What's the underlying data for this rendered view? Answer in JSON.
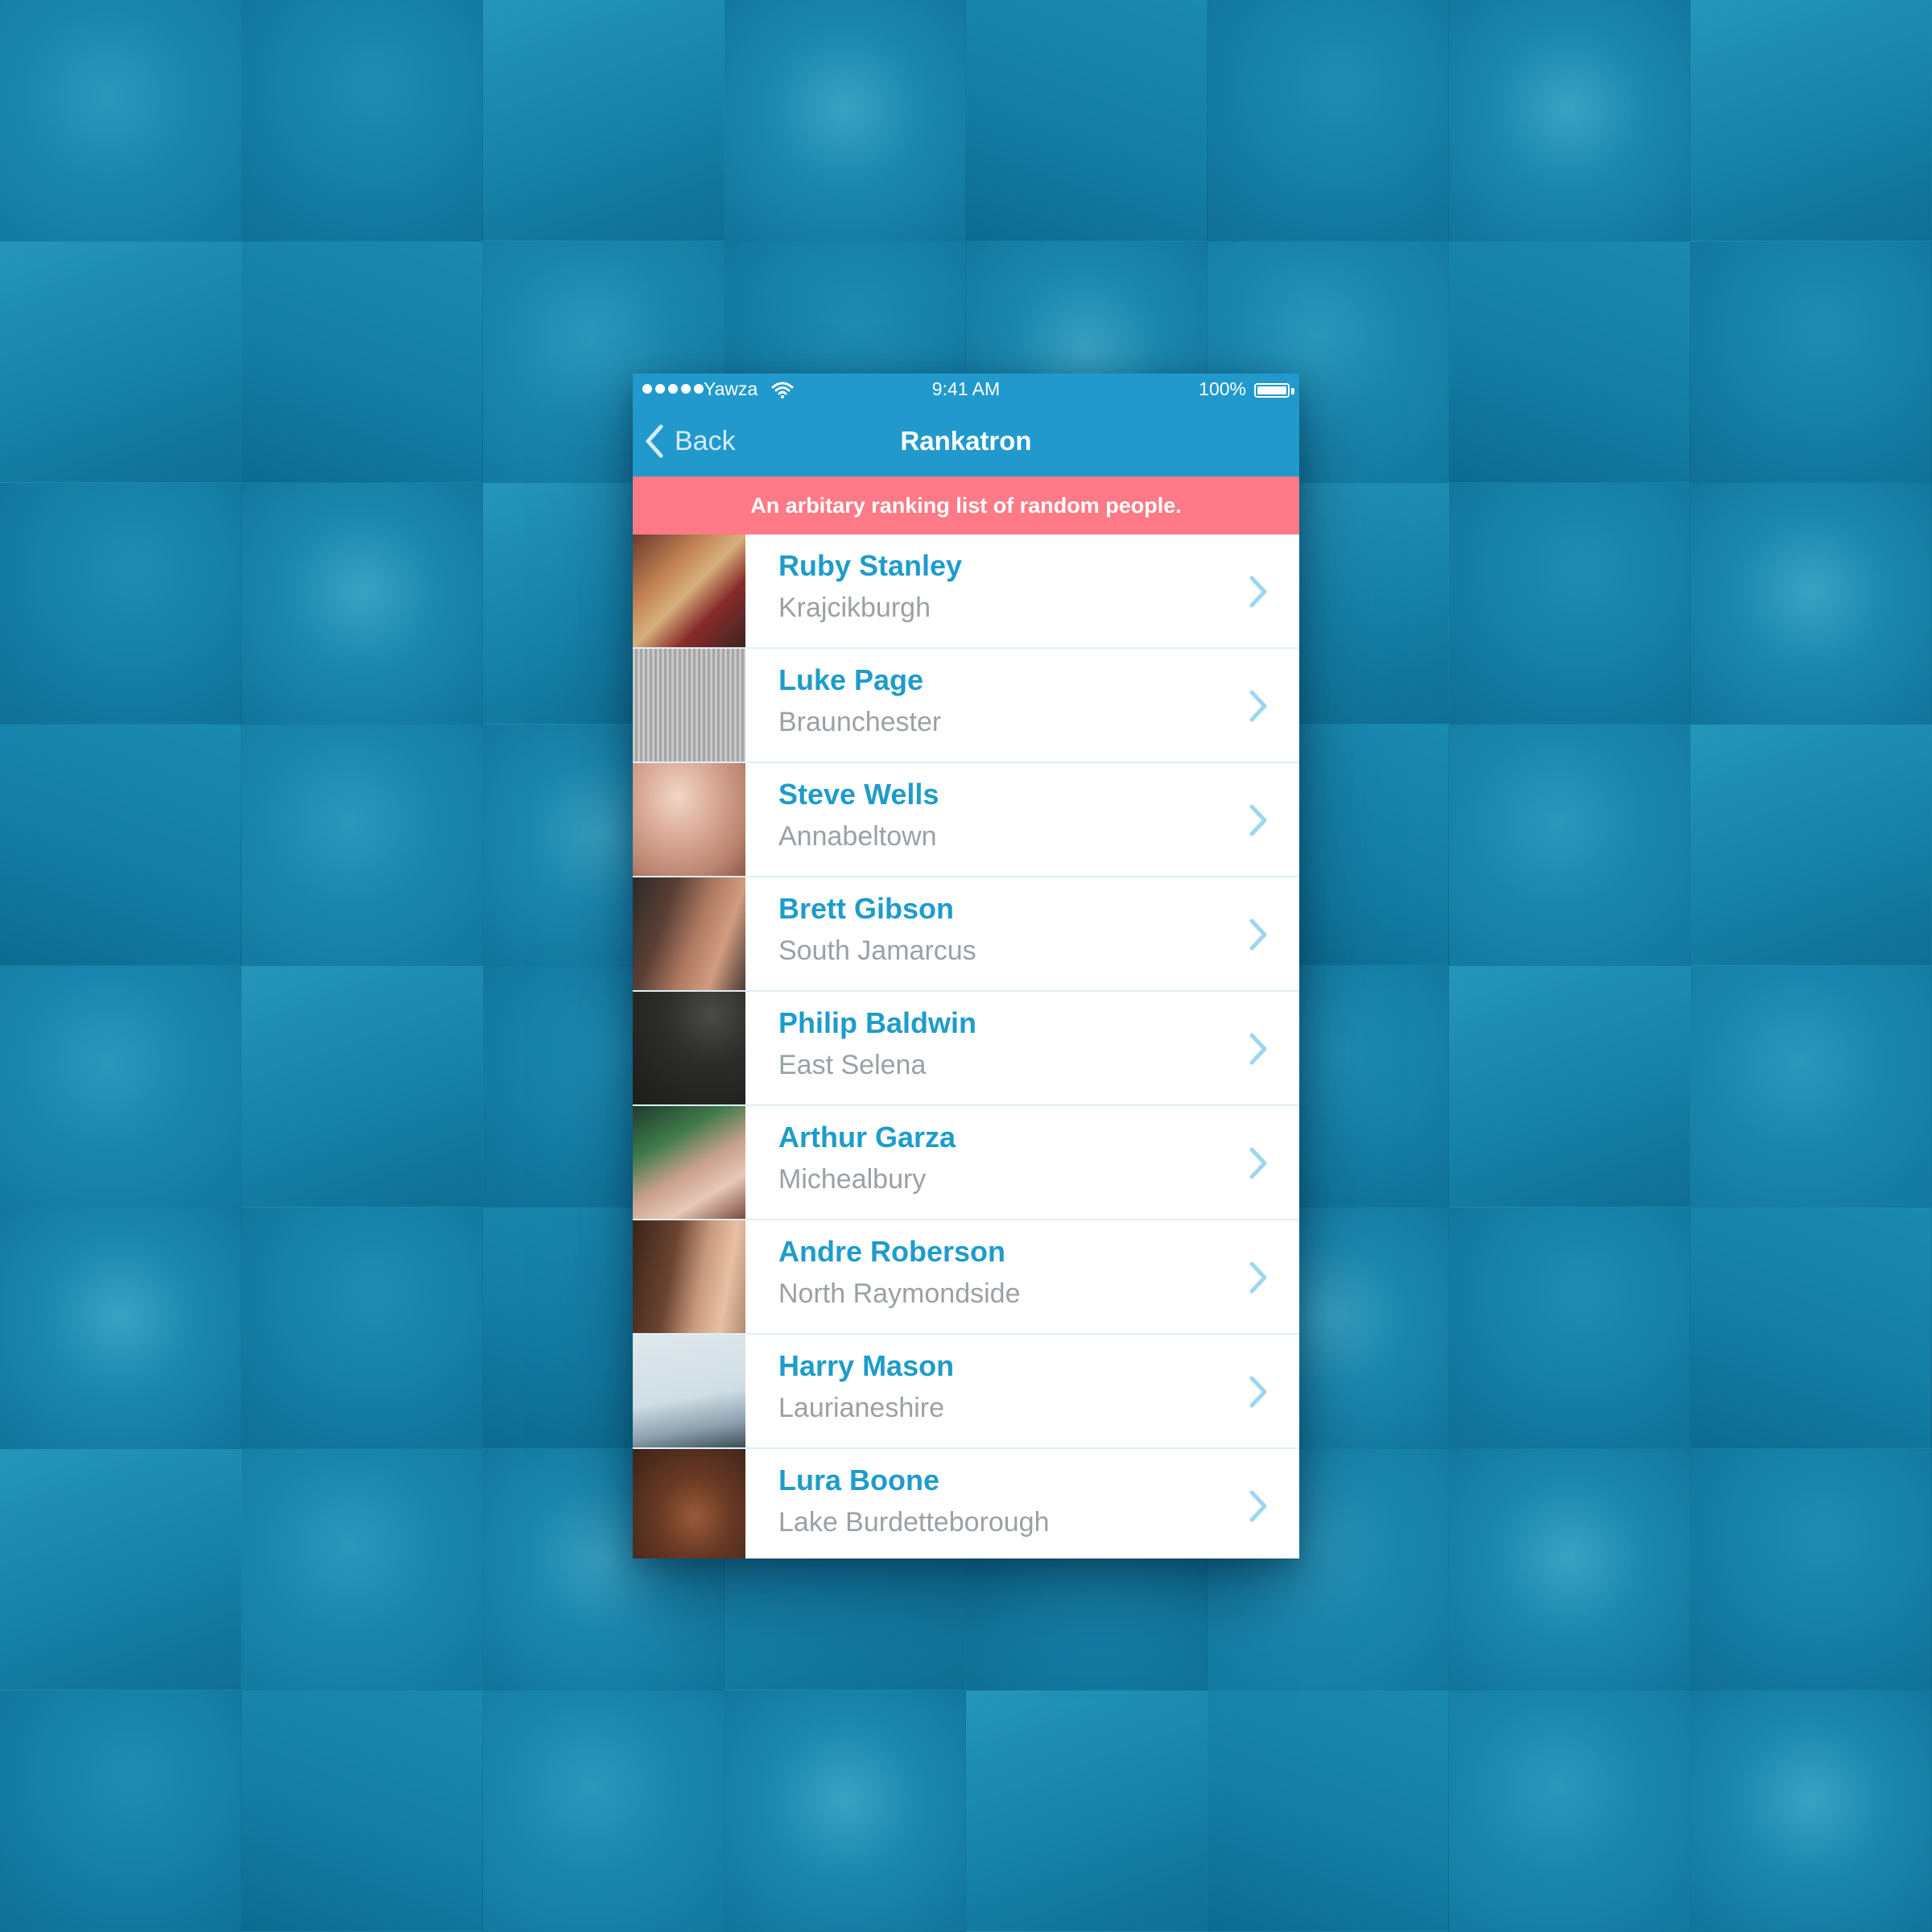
{
  "status_bar": {
    "carrier": "Yawza",
    "time": "9:41 AM",
    "battery": "100%"
  },
  "nav": {
    "back_label": "Back",
    "title": "Rankatron"
  },
  "banner": {
    "text": "An arbitary ranking list of random people."
  },
  "people": [
    {
      "name": "Ruby Stanley",
      "city": "Krajcikburgh"
    },
    {
      "name": "Luke Page",
      "city": "Braunchester"
    },
    {
      "name": "Steve Wells",
      "city": "Annabeltown"
    },
    {
      "name": "Brett Gibson",
      "city": "South Jamarcus"
    },
    {
      "name": "Philip Baldwin",
      "city": "East Selena"
    },
    {
      "name": "Arthur Garza",
      "city": "Michealbury"
    },
    {
      "name": "Andre Roberson",
      "city": "North Raymondside"
    },
    {
      "name": "Harry Mason",
      "city": "Laurianeshire"
    },
    {
      "name": "Lura Boone",
      "city": "Lake Burdetteborough"
    }
  ],
  "icons": {
    "back": "chevron-left-icon",
    "row_disclosure": "chevron-right-icon",
    "wifi": "wifi-icon",
    "battery": "battery-icon",
    "signal": "signal-dots-icon"
  },
  "colors": {
    "nav_blue": "#2199cc",
    "banner_pink": "#ff7a86",
    "name_blue": "#1e9ccb",
    "city_gray": "#9aa1a6",
    "chevron_light_blue": "#9fd6ef",
    "background_blue": "#137fa6"
  }
}
